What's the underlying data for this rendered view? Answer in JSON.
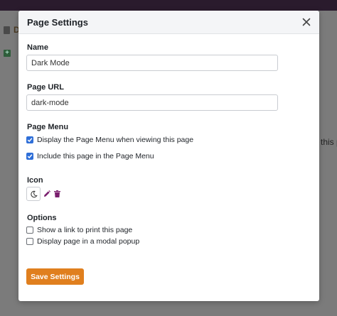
{
  "background": {
    "side_letter": "D",
    "partial_text": "this p"
  },
  "modal": {
    "title": "Page Settings",
    "close_icon": "close-icon",
    "name": {
      "label": "Name",
      "value": "Dark Mode"
    },
    "page_url": {
      "label": "Page URL",
      "value": "dark-mode"
    },
    "page_menu": {
      "label": "Page Menu",
      "options": [
        {
          "label": "Display the Page Menu when viewing this page",
          "checked": true
        },
        {
          "label": "Include this page in the Page Menu",
          "checked": true
        }
      ]
    },
    "icon": {
      "label": "Icon",
      "selected_icon": "moon-icon",
      "edit_icon": "pencil-icon",
      "delete_icon": "trash-icon"
    },
    "options": {
      "label": "Options",
      "items": [
        {
          "label": "Show a link to print this page",
          "checked": false
        },
        {
          "label": "Display page in a modal popup",
          "checked": false
        }
      ]
    },
    "save_label": "Save Settings"
  },
  "colors": {
    "accent": "#e07f1e",
    "checkbox": "#2f6fd8",
    "icon_purple": "#7a1f6e",
    "topbar": "#2a1b2d"
  }
}
